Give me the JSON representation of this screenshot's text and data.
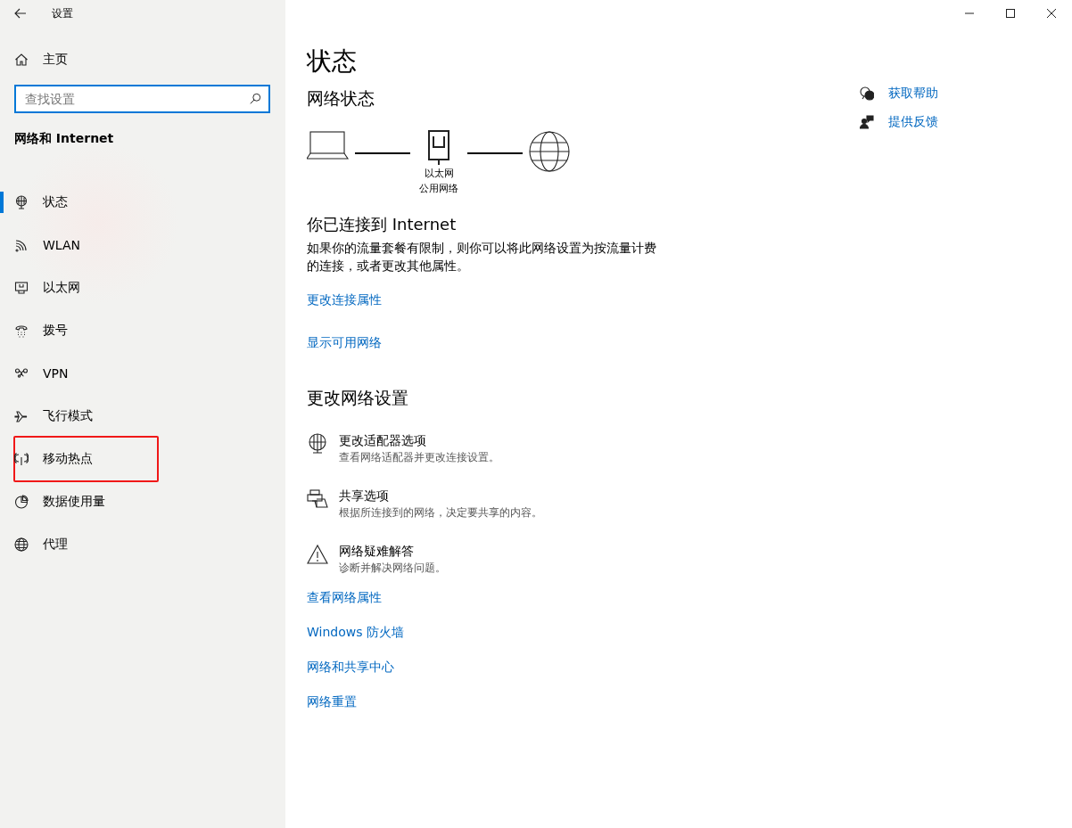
{
  "window": {
    "title": "设置"
  },
  "sidebar": {
    "home": "主页",
    "search": {
      "placeholder": "查找设置"
    },
    "section": "网络和 Internet",
    "items": [
      {
        "label": "状态",
        "selected": true,
        "highlighted": false
      },
      {
        "label": "WLAN",
        "selected": false,
        "highlighted": false
      },
      {
        "label": "以太网",
        "selected": false,
        "highlighted": false
      },
      {
        "label": "拨号",
        "selected": false,
        "highlighted": false
      },
      {
        "label": "VPN",
        "selected": false,
        "highlighted": false
      },
      {
        "label": "飞行模式",
        "selected": false,
        "highlighted": false
      },
      {
        "label": "移动热点",
        "selected": false,
        "highlighted": true
      },
      {
        "label": "数据使用量",
        "selected": false,
        "highlighted": false
      },
      {
        "label": "代理",
        "selected": false,
        "highlighted": false
      }
    ]
  },
  "main": {
    "title": "状态",
    "network_status": {
      "heading": "网络状态",
      "adapter_label": "以太网",
      "network_label": "公用网络"
    },
    "connected": {
      "heading": "你已连接到 Internet",
      "description": "如果你的流量套餐有限制，则你可以将此网络设置为按流量计费的连接，或者更改其他属性。",
      "links": [
        "更改连接属性",
        "显示可用网络"
      ]
    },
    "change_settings": {
      "heading": "更改网络设置",
      "options": [
        {
          "title": "更改适配器选项",
          "subtitle": "查看网络适配器并更改连接设置。"
        },
        {
          "title": "共享选项",
          "subtitle": "根据所连接到的网络，决定要共享的内容。"
        },
        {
          "title": "网络疑难解答",
          "subtitle": "诊断并解决网络问题。"
        }
      ]
    },
    "links": [
      "查看网络属性",
      "Windows 防火墙",
      "网络和共享中心",
      "网络重置"
    ]
  },
  "help": {
    "links": [
      "获取帮助",
      "提供反馈"
    ]
  }
}
